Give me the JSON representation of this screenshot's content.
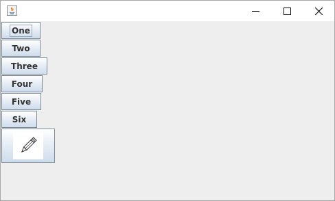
{
  "window": {
    "title": "",
    "controls": {
      "minimize": "minimize",
      "maximize": "maximize",
      "close": "close"
    }
  },
  "buttons": [
    {
      "label": "One"
    },
    {
      "label": "Two"
    },
    {
      "label": "Three"
    },
    {
      "label": "Four"
    },
    {
      "label": "Five"
    },
    {
      "label": "Six"
    }
  ],
  "icon_button": {
    "icon": "pencil-icon"
  },
  "colors": {
    "content_bg": "#eeeeee",
    "button_border": "#7a8a99",
    "button_text": "#333333"
  }
}
